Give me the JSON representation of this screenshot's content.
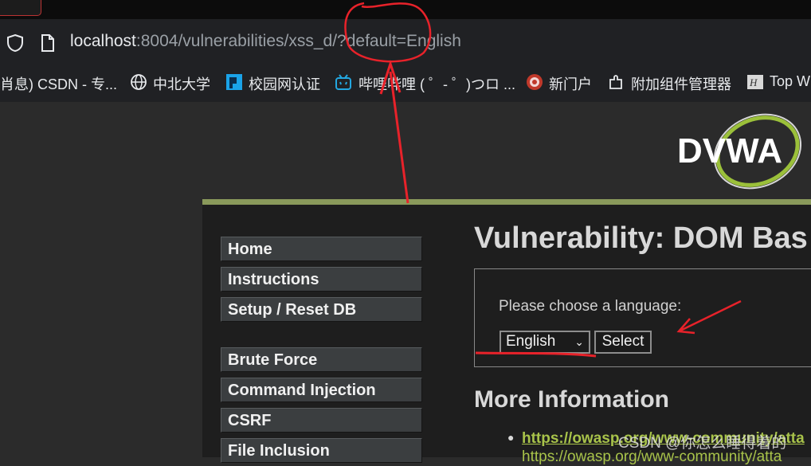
{
  "browser": {
    "url_host": "localhost",
    "url_path": ":8004/vulnerabilities/xss_d/?default=English",
    "bookmarks": [
      {
        "label": "肖息) CSDN - 专..."
      },
      {
        "label": "中北大学"
      },
      {
        "label": "校园网认证"
      },
      {
        "label": "哔哩哔哩 ( ゜- ゜)つロ ..."
      },
      {
        "label": "新门户"
      },
      {
        "label": "附加组件管理器"
      },
      {
        "label": "Top W"
      }
    ]
  },
  "logo": {
    "text": "DVWA",
    "color": "#ffffff",
    "accent": "#9bc03a"
  },
  "menu": {
    "items": [
      {
        "label": "Home"
      },
      {
        "label": "Instructions"
      },
      {
        "label": "Setup / Reset DB"
      },
      {
        "label": "Brute Force"
      },
      {
        "label": "Command Injection"
      },
      {
        "label": "CSRF"
      },
      {
        "label": "File Inclusion"
      }
    ]
  },
  "main": {
    "title": "Vulnerability: DOM Bas",
    "lang_label": "Please choose a language:",
    "selected_language": "English",
    "select_button": "Select",
    "more_info_title": "More Information",
    "links": [
      "https://owasp.org/www-community/atta",
      "https://owasp.org/www-community/atta"
    ]
  },
  "watermark": "CSDN @你怎么睡得着的",
  "colors": {
    "annotation_red": "#e8222a",
    "accent_green": "#8a9a5b",
    "link_green": "#a8c34a"
  }
}
